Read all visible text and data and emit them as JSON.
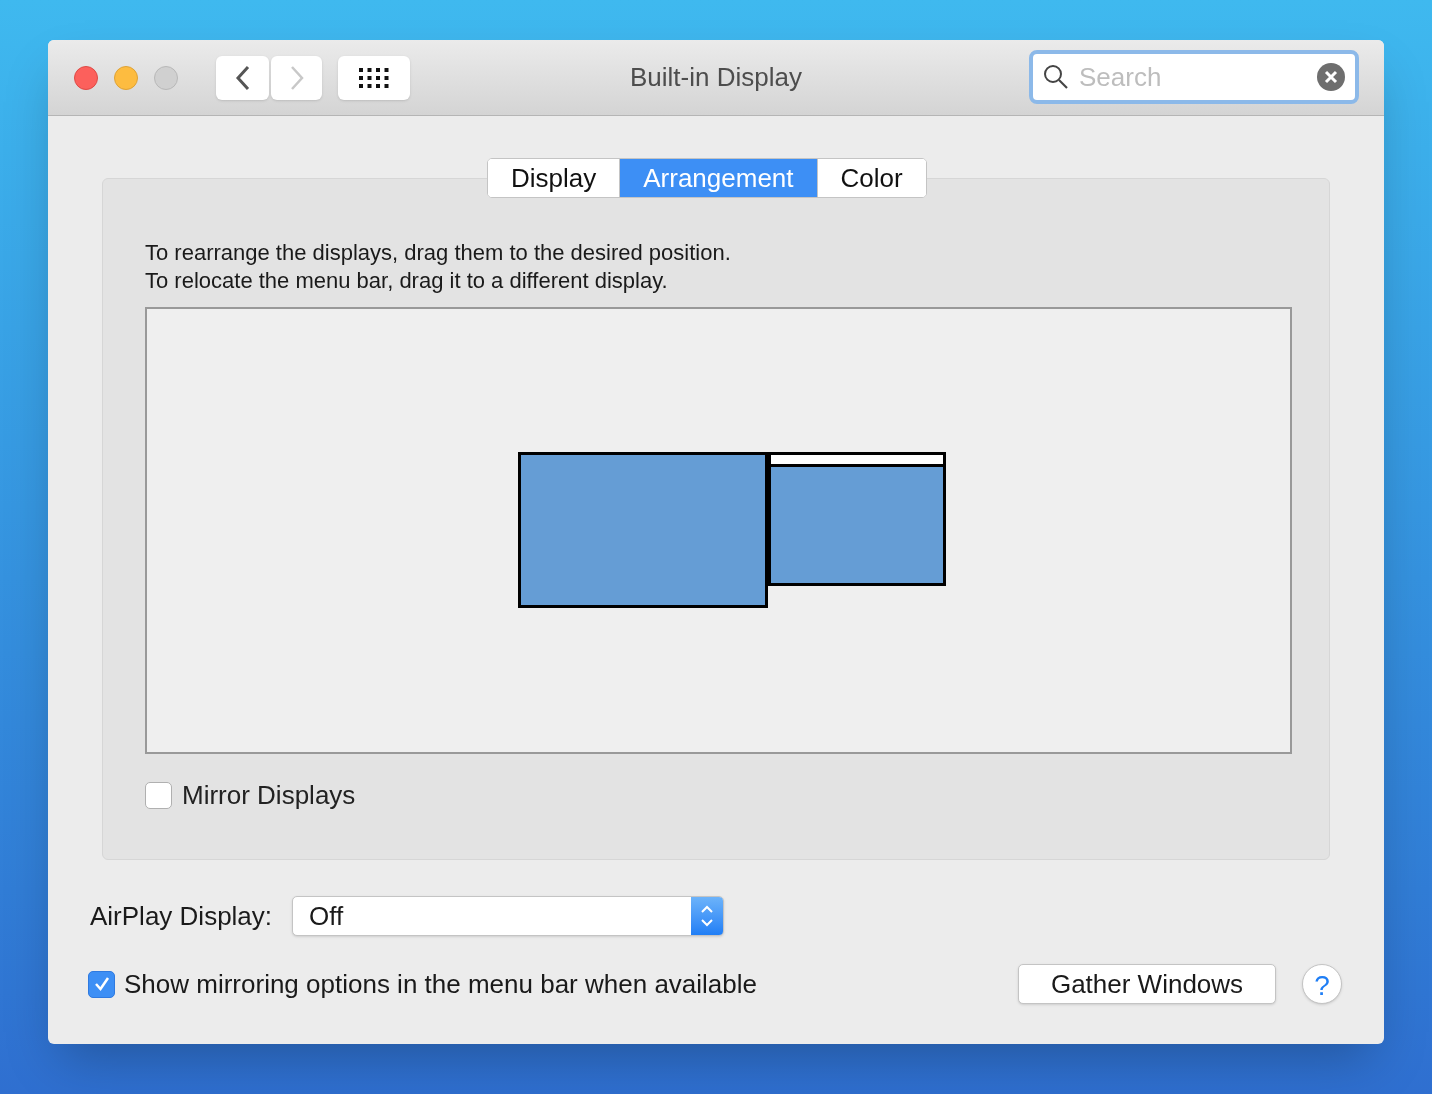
{
  "window": {
    "title": "Built-in Display"
  },
  "toolbar": {
    "back": {
      "disabled": false
    },
    "forward": {
      "disabled": true
    }
  },
  "search": {
    "placeholder": "Search"
  },
  "tabs": [
    {
      "label": "Display",
      "selected": false
    },
    {
      "label": "Arrangement",
      "selected": true
    },
    {
      "label": "Color",
      "selected": false
    }
  ],
  "instructions": [
    "To rearrange the displays, drag them to the desired position.",
    "To relocate the menu bar, drag it to a different display."
  ],
  "displays": [
    {
      "menu_bar": false
    },
    {
      "menu_bar": true
    }
  ],
  "mirror_displays": {
    "label": "Mirror Displays",
    "checked": false
  },
  "airplay": {
    "label": "AirPlay Display:",
    "value": "Off"
  },
  "show_mirroring": {
    "label": "Show mirroring options in the menu bar when available",
    "checked": true
  },
  "buttons": {
    "gather": "Gather Windows",
    "help": "?"
  }
}
